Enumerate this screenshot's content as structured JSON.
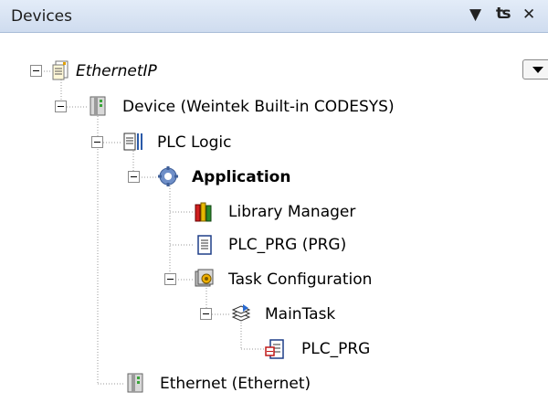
{
  "panel": {
    "title": "Devices",
    "controls": {
      "dropdown_icon": "chevron-down-icon",
      "pin_icon": "pin-icon",
      "close_icon": "close-icon"
    }
  },
  "tree": {
    "items": [
      {
        "label": "EthernetIP",
        "icon": "project-icon",
        "style": "italic",
        "expanded": true
      },
      {
        "label": "Device (Weintek Built-in CODESYS)",
        "icon": "device-icon",
        "expanded": true
      },
      {
        "label": "PLC Logic",
        "icon": "plc-logic-icon",
        "expanded": true
      },
      {
        "label": "Application",
        "icon": "application-gear-icon",
        "style": "bold",
        "expanded": true
      },
      {
        "label": "Library Manager",
        "icon": "library-books-icon"
      },
      {
        "label": "PLC_PRG (PRG)",
        "icon": "document-icon"
      },
      {
        "label": "Task Configuration",
        "icon": "task-configuration-icon",
        "expanded": true
      },
      {
        "label": "MainTask",
        "icon": "task-icon",
        "expanded": true
      },
      {
        "label": "PLC_PRG",
        "icon": "program-call-icon"
      },
      {
        "label": "Ethernet (Ethernet)",
        "icon": "ethernet-device-icon"
      }
    ]
  }
}
